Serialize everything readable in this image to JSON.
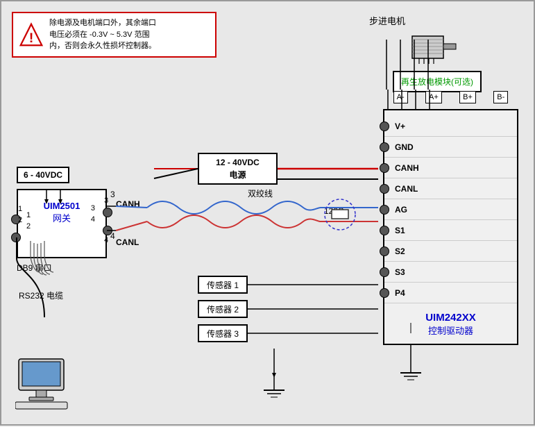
{
  "warning": {
    "text": "除电源及电机端口外，其余端口\n电压必须在 -0.3V ~ 5.3V 范围\n内，否则会永久性损坏控制器。"
  },
  "stepper": {
    "label": "步进电机"
  },
  "regen": {
    "label": "再生放电模块(可选)"
  },
  "power_supply": {
    "label": "12 - 40VDC\n电源"
  },
  "power_input": {
    "label": "6 - 40VDC"
  },
  "gateway": {
    "name": "UIM2501",
    "sublabel": "网关"
  },
  "db9": {
    "label": "DB9 串口"
  },
  "rs232": {
    "label": "RS232 电缆"
  },
  "can_labels": {
    "canh": "CANH",
    "canl": "CANL",
    "twisted": "双绞线",
    "resistor": "120Ω"
  },
  "terminals": {
    "vplus": "V+",
    "gnd": "GND",
    "canh": "CANH",
    "canl": "CANL",
    "ag": "AG",
    "s1": "S1",
    "s2": "S2",
    "s3": "S3",
    "p4": "P4"
  },
  "motor_connectors": {
    "a_minus": "A-",
    "a_plus": "A+",
    "b_plus": "B+",
    "b_minus": "B-"
  },
  "sensors": {
    "s1": "传感器 1",
    "s2": "传感器 2",
    "s3": "传感器 3"
  },
  "controller": {
    "name": "UIM242XX",
    "sublabel": "控制驱动器"
  },
  "port_numbers": {
    "p1": "1",
    "p2": "2",
    "p3": "3",
    "p4": "4"
  }
}
